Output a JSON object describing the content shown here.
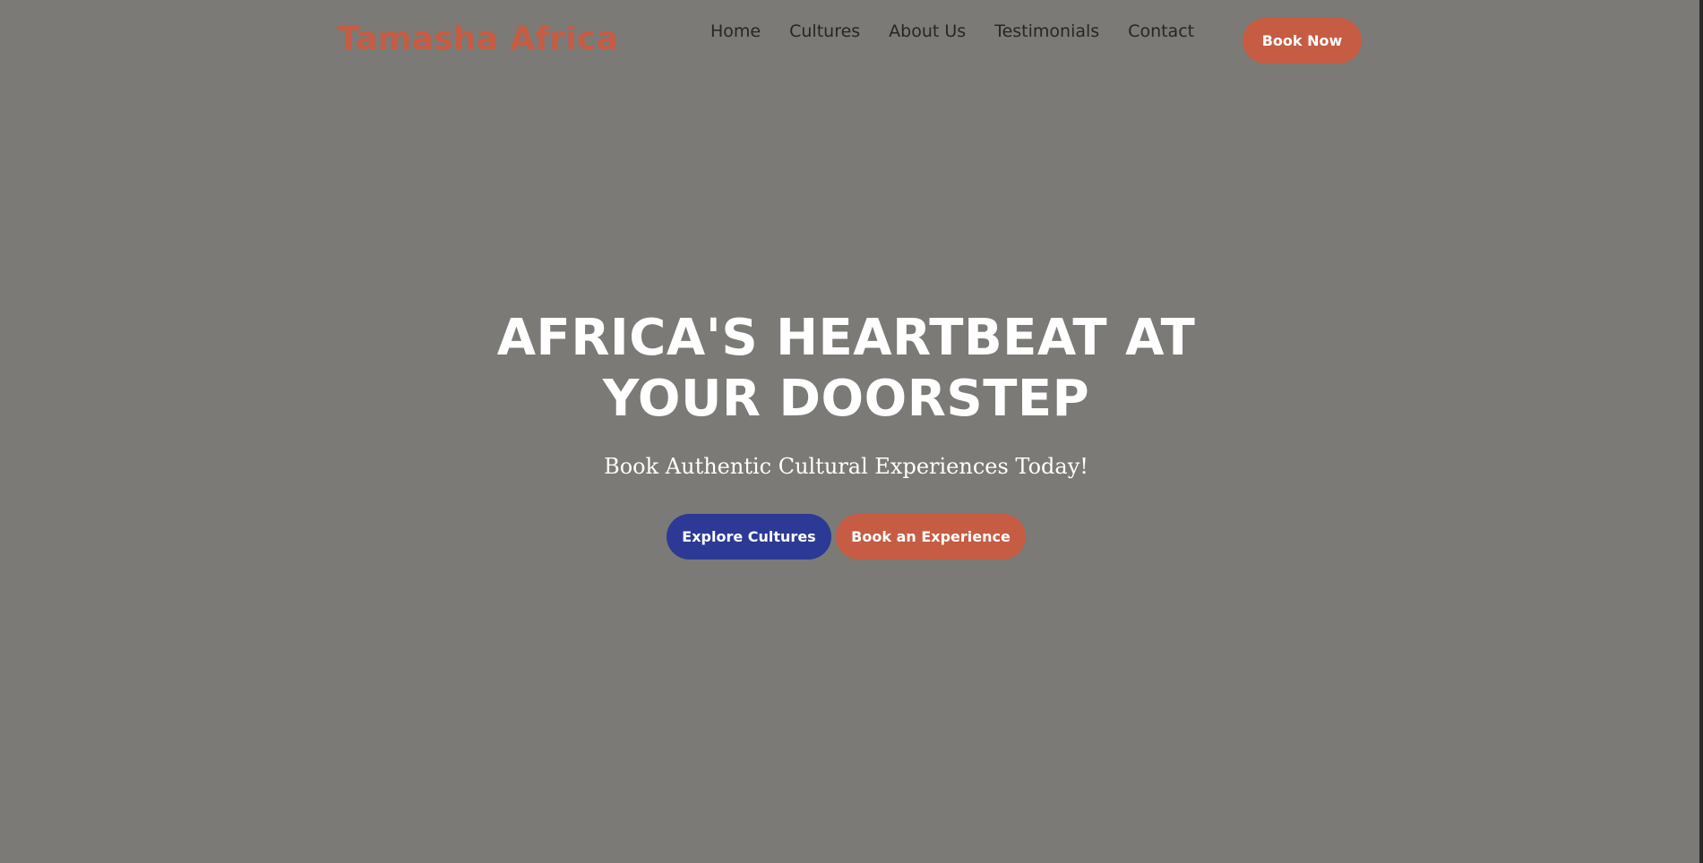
{
  "header": {
    "logo_text": "Tamasha Africa",
    "nav": [
      {
        "label": "Home"
      },
      {
        "label": "Cultures"
      },
      {
        "label": "About Us"
      },
      {
        "label": "Testimonials"
      },
      {
        "label": "Contact"
      }
    ],
    "book_now_label": "Book Now"
  },
  "hero": {
    "title_line1": "AFRICA'S HEARTBEAT AT",
    "title_line2": "YOUR DOORSTEP",
    "subtitle": "Book Authentic Cultural Experiences Today!",
    "buttons": {
      "explore_label": "Explore Cultures",
      "book_label": "Book an Experience"
    }
  },
  "colors": {
    "accent": "#c65c43",
    "secondary": "#2c3a96",
    "overlay_background": "#7b7a76",
    "nav_text": "#262626",
    "hero_text": "#ffffff"
  }
}
